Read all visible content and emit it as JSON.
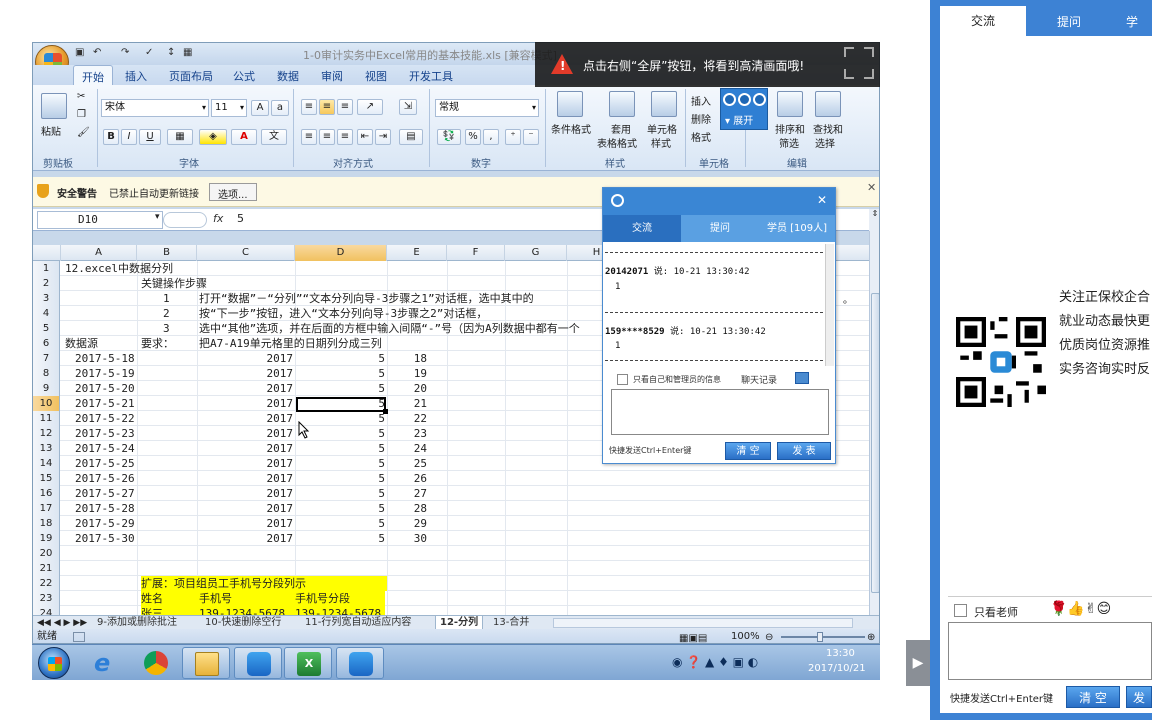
{
  "excel": {
    "title": "1-0审计实务中Excel常用的基本技能.xls  [兼容模式]",
    "ribbon_tabs": [
      "开始",
      "插入",
      "页面布局",
      "公式",
      "数据",
      "审阅",
      "视图",
      "开发工具"
    ],
    "clipboard": {
      "paste": "粘贴",
      "label": "剪贴板"
    },
    "font": {
      "name": "宋体",
      "size": "11",
      "label": "字体",
      "bold": "B",
      "italic": "I",
      "underline": "U"
    },
    "alignment": {
      "label": "对齐方式"
    },
    "number": {
      "format": "常规",
      "label": "数字",
      "percent": "%",
      "comma": ","
    },
    "styles": {
      "cond": "条件格式",
      "table": "套用",
      "table2": "表格格式",
      "cell": "单元格",
      "cell2": "样式",
      "label": "样式"
    },
    "cells": {
      "insert": "插入",
      "delete": "删除",
      "format": "格式",
      "label": "单元格"
    },
    "editing": {
      "sort": "排序和",
      "sort2": "筛选",
      "find": "查找和",
      "find2": "选择",
      "label": "编辑"
    },
    "security": {
      "warning": "安全警告",
      "text": "已禁止自动更新链接",
      "options": "选项..."
    },
    "namebox": "D10",
    "fx": "fx",
    "formula": "5",
    "columns": [
      "A",
      "B",
      "C",
      "D",
      "E",
      "F",
      "G",
      "H"
    ],
    "rows": [
      {
        "n": "1",
        "a": "12.excel中数据分列"
      },
      {
        "n": "2",
        "b": "关键操作步骤"
      },
      {
        "n": "3",
        "b": "1",
        "c": "打开“数据”－“分列”“文本分列向导-3步骤之1”对话框，选中其中的"
      },
      {
        "n": "4",
        "b": "2",
        "c": "按“下一步”按钮，进入“文本分列向导-3步骤之2”对话框，"
      },
      {
        "n": "5",
        "b": "3",
        "c": "选中“其他”选项，并在后面的方框中输入间隔“-”号（因为A列数据中都有一个"
      },
      {
        "n": "6",
        "a": "数据源",
        "b": "要求：",
        "c": "把A7-A19单元格里的日期列分成三列"
      },
      {
        "n": "7",
        "a": "2017-5-18",
        "c": "2017",
        "d": "5",
        "e": "18"
      },
      {
        "n": "8",
        "a": "2017-5-19",
        "c": "2017",
        "d": "5",
        "e": "19"
      },
      {
        "n": "9",
        "a": "2017-5-20",
        "c": "2017",
        "d": "5",
        "e": "20"
      },
      {
        "n": "10",
        "a": "2017-5-21",
        "c": "2017",
        "d": "5",
        "e": "21"
      },
      {
        "n": "11",
        "a": "2017-5-22",
        "c": "2017",
        "d": "5",
        "e": "22"
      },
      {
        "n": "12",
        "a": "2017-5-23",
        "c": "2017",
        "d": "5",
        "e": "23"
      },
      {
        "n": "13",
        "a": "2017-5-24",
        "c": "2017",
        "d": "5",
        "e": "24"
      },
      {
        "n": "14",
        "a": "2017-5-25",
        "c": "2017",
        "d": "5",
        "e": "25"
      },
      {
        "n": "15",
        "a": "2017-5-26",
        "c": "2017",
        "d": "5",
        "e": "26"
      },
      {
        "n": "16",
        "a": "2017-5-27",
        "c": "2017",
        "d": "5",
        "e": "27"
      },
      {
        "n": "17",
        "a": "2017-5-28",
        "c": "2017",
        "d": "5",
        "e": "28"
      },
      {
        "n": "18",
        "a": "2017-5-29",
        "c": "2017",
        "d": "5",
        "e": "29"
      },
      {
        "n": "19",
        "a": "2017-5-30",
        "c": "2017",
        "d": "5",
        "e": "30"
      },
      {
        "n": "20"
      },
      {
        "n": "21"
      },
      {
        "n": "22",
        "b": "扩展：项目组员工手机号分段列示"
      },
      {
        "n": "23",
        "b": "姓名",
        "c": "手机号",
        "d": "手机号分段"
      },
      {
        "n": "24",
        "b": "张三",
        "c": "139-1234-5678",
        "d": "139-1234-5678"
      }
    ],
    "sheet_tabs": [
      "9-添加或删除批注",
      "10-快速删除空行",
      "11-行列宽自动适应内容",
      "12-分列",
      "13-合并"
    ],
    "status": "就绪",
    "zoom": "100%"
  },
  "banner": {
    "text": "点击右侧“全屏”按钮，将看到高清画面哦!",
    "warn": "!"
  },
  "minitoolbar": {
    "expand": "展开"
  },
  "popup": {
    "tabs": [
      "交流",
      "提问",
      "学员 [109人]"
    ],
    "messages": [
      {
        "user": "20142071",
        "said": "说:",
        "time": "10-21 13:30:42",
        "body": "1"
      },
      {
        "user": "159****8529",
        "said": "说:",
        "time": "10-21 13:30:42",
        "body": "1"
      }
    ],
    "only_self": "只看自己和管理员的信息",
    "chat_log": "聊天记录",
    "hint": "快捷发送Ctrl+Enter键",
    "clear": "清 空",
    "send": "发 表"
  },
  "taskbar": {
    "time": "13:30",
    "date": "2017/10/21"
  },
  "right_panel": {
    "tabs": [
      "交流",
      "提问",
      "学"
    ],
    "lines": [
      "关注正保校企合",
      "就业动态最快更",
      "优质岗位资源推",
      "实务咨询实时反"
    ],
    "only_teacher": "只看老师",
    "hint": "快捷发送Ctrl+Enter键",
    "clear": "清 空",
    "send": "发"
  }
}
